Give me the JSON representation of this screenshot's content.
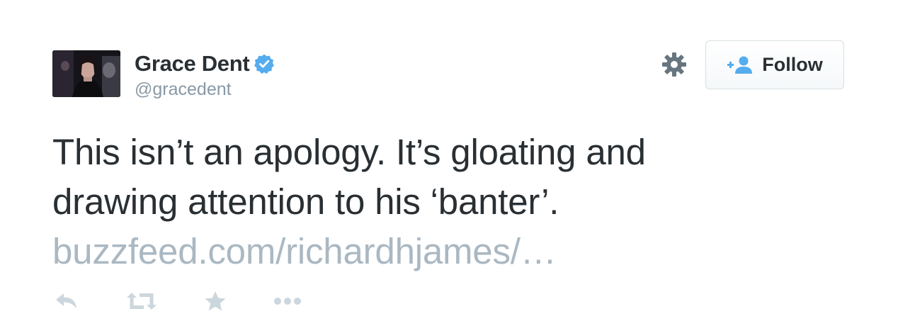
{
  "tweet": {
    "author": {
      "display_name": "Grace Dent",
      "handle": "@gracedent",
      "verified": true,
      "avatar_icon": "avatar-photo"
    },
    "follow_button": {
      "label": "Follow",
      "icon": "add-user-icon"
    },
    "settings_icon": "gear-icon",
    "text_lines": [
      "This isn’t an apology. It’s gloating and",
      "drawing attention to his ‘banter’."
    ],
    "link": "buzzfeed.com/richardhjames/…",
    "actions": [
      {
        "name": "reply",
        "icon": "reply-icon"
      },
      {
        "name": "retweet",
        "icon": "retweet-icon"
      },
      {
        "name": "favorite",
        "icon": "star-icon"
      },
      {
        "name": "more",
        "icon": "more-icon"
      }
    ],
    "colors": {
      "text": "#292f33",
      "muted": "#8899a6",
      "link": "#aab8c2",
      "verified": "#55acee",
      "icon": "#ccd6dd",
      "gear": "#66757f"
    }
  }
}
